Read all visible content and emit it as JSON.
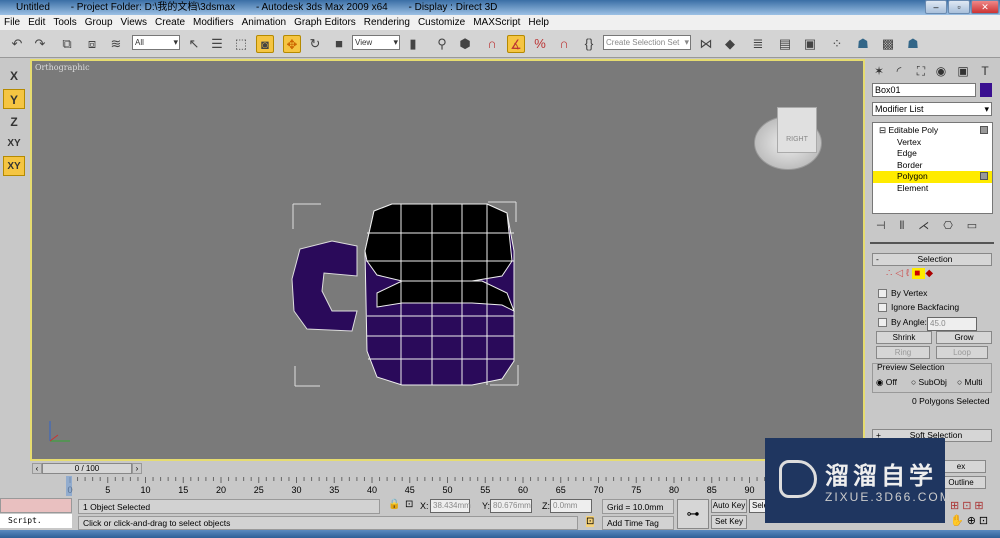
{
  "window": {
    "title_parts": [
      "Untitled",
      "- Project Folder: D:\\我的文档\\3dsmax",
      "- Autodesk 3ds Max  2009 x64",
      "- Display : Direct 3D"
    ]
  },
  "menu": [
    "File",
    "Edit",
    "Tools",
    "Group",
    "Views",
    "Create",
    "Modifiers",
    "Animation",
    "Graph Editors",
    "Rendering",
    "Customize",
    "MAXScript",
    "Help"
  ],
  "toolbar": {
    "selection_filter": "All",
    "reference_coord": "View",
    "named_selection_placeholder": "Create Selection Set",
    "active_tool": "select-and-move"
  },
  "axis_constraints": [
    "X",
    "Y",
    "Z",
    "XY",
    "XY"
  ],
  "viewport": {
    "label": "Orthographic",
    "viewcube_face": "RIGHT",
    "object_color": "#2a0a5a"
  },
  "command_panel": {
    "object_name": "Box01",
    "object_color": "#3a1090",
    "modifier_list": "Modifier List",
    "stack": [
      {
        "label": "Editable Poly",
        "top": true
      },
      {
        "label": "Vertex"
      },
      {
        "label": "Edge"
      },
      {
        "label": "Border"
      },
      {
        "label": "Polygon",
        "selected": true
      },
      {
        "label": "Element"
      }
    ],
    "selection_rollout": "Selection",
    "by_vertex": "By Vertex",
    "ignore_backfacing": "Ignore Backfacing",
    "by_angle": "By Angle:",
    "angle_value": "45.0",
    "shrink": "Shrink",
    "grow": "Grow",
    "ring": "Ring",
    "loop": "Loop",
    "preview_selection": "Preview Selection",
    "preview_options": [
      "Off",
      "SubObj",
      "Multi"
    ],
    "preview_selected": "Off",
    "selected_count": "0 Polygons Selected",
    "soft_selection": "Soft Selection",
    "partial": [
      "ex",
      "Outline"
    ]
  },
  "timeline": {
    "frame": "0 / 100",
    "ticks": [
      "0",
      "5",
      "10",
      "15",
      "20",
      "25",
      "30",
      "35",
      "40",
      "45",
      "50",
      "55",
      "60",
      "65",
      "70",
      "75",
      "80",
      "85",
      "90"
    ]
  },
  "status": {
    "script": "Script.",
    "selected": "1 Object Selected",
    "prompt": "Click or click-and-drag to select objects",
    "x_label": "X:",
    "x": "38.434mm",
    "y_label": "Y:",
    "y": "80.676mm",
    "z_label": "Z:",
    "z": "0.0mm",
    "grid": "Grid = 10.0mm",
    "add_time_tag": "Add Time Tag",
    "auto_key": "Auto Key",
    "set_key": "Set Key",
    "key_filter": "Sele"
  },
  "watermark": {
    "brand": "溜溜自学",
    "url": "ZIXUE.3D66.COM"
  }
}
